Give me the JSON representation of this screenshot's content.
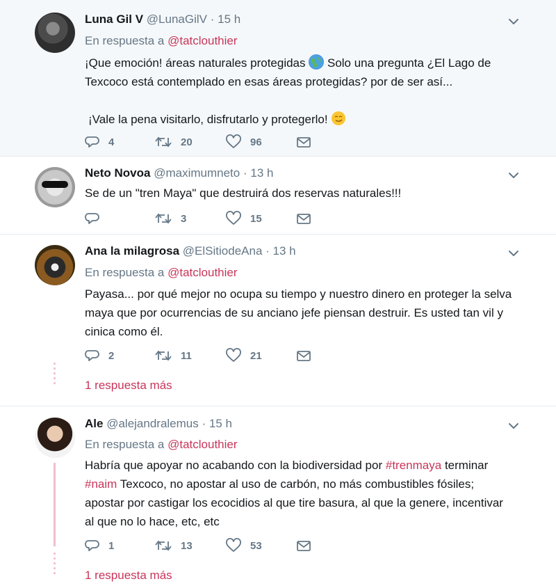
{
  "tweets": [
    {
      "name": "Luna Gil V",
      "handle": "@LunaGilV",
      "dot": "·",
      "time": "15 h",
      "reply_prefix": "En respuesta a",
      "reply_mention": "@tatclouthier",
      "text_a": "¡Que emoción! áreas naturales protegidas",
      "text_b": "Solo una pregunta ¿El Lago de Texcoco está contemplado en esas áreas protegidas? por de ser así...",
      "text_c": "¡Vale la pena visitarlo, disfrutarlo y protegerlo!",
      "replies": "4",
      "retweets": "20",
      "likes": "96",
      "earth_emoji": "earth-globe-americas-icon",
      "smile_emoji": "smirking-face-icon"
    },
    {
      "name": "Neto Novoa",
      "handle": "@maximumneto",
      "dot": "·",
      "time": "13 h",
      "text": "Se de un \"tren Maya\" que destruirá dos reservas naturales!!!",
      "replies": "",
      "retweets": "3",
      "likes": "15"
    },
    {
      "name": "Ana la milagrosa",
      "handle": "@ElSitiodeAna",
      "dot": "·",
      "time": "13 h",
      "reply_prefix": "En respuesta a",
      "reply_mention": "@tatclouthier",
      "text_l1": "Payasa... por qué mejor no ocupa su tiempo y nuestro dinero en proteger la selva",
      "text_l2": "maya que por ocurrencias de su anciano jefe piensan destruir. Es usted tan vil y",
      "text_l3": "cinica como él.",
      "replies": "2",
      "retweets": "11",
      "likes": "21",
      "more_replies": "1 respuesta más"
    },
    {
      "name": "Ale",
      "handle": "@alejandralemus",
      "dot": "·",
      "time": "15 h",
      "reply_prefix": "En respuesta a",
      "reply_mention": "@tatclouthier",
      "text_l1_a": "Habría que apoyar no acabando con la biodiversidad por",
      "hashtag_1": "#trenmaya",
      "text_l1_b": "terminar",
      "hashtag_2": "#naim",
      "text_l2": "Texcoco, no apostar al uso de carbón, no más combustibles fósiles;",
      "text_l3": "apostar por castigar los ecocidios al que tire basura, al que la genere, incentivar",
      "text_l4": "al que no lo hace, etc, etc",
      "replies": "1",
      "retweets": "13",
      "likes": "53",
      "more_replies": "1 respuesta más"
    }
  ],
  "icons": {
    "reply": "reply-icon",
    "retweet": "retweet-icon",
    "like": "like-heart-icon",
    "dm": "direct-message-envelope-icon",
    "caret": "chevron-down-icon"
  },
  "colors": {
    "accent": "#c8365a",
    "muted": "#657786",
    "thread": "#f2bfcd",
    "highlight_bg": "#f5f8fa"
  }
}
